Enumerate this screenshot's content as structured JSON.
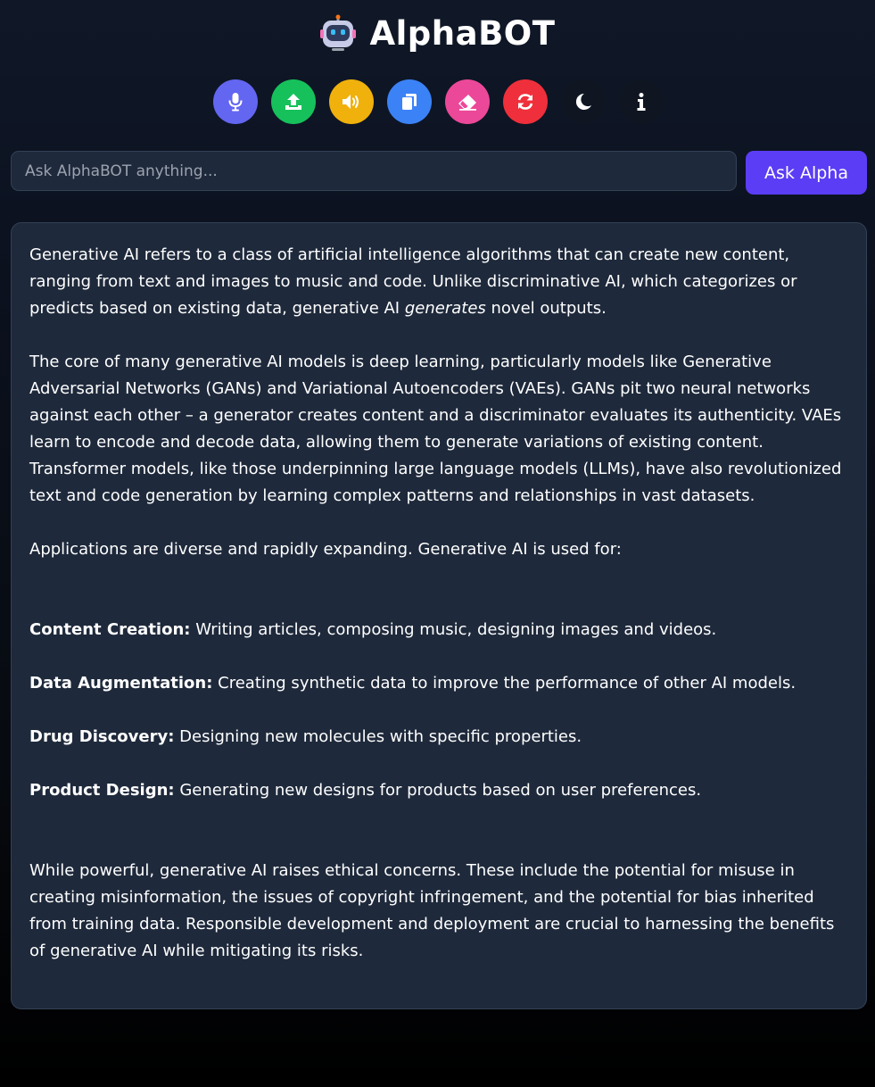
{
  "app": {
    "title": "AlphaBOT",
    "logo_icon": "robot-icon"
  },
  "toolbar": {
    "buttons": [
      {
        "name": "microphone-icon",
        "color": "#6366f1"
      },
      {
        "name": "upload-icon",
        "color": "#16c15b"
      },
      {
        "name": "speaker-icon",
        "color": "#f0b10c"
      },
      {
        "name": "copy-icon",
        "color": "#3b82f6"
      },
      {
        "name": "eraser-icon",
        "color": "#ec4899"
      },
      {
        "name": "refresh-icon",
        "color": "#ef2f3b"
      },
      {
        "name": "moon-icon",
        "color": "#0f1622"
      },
      {
        "name": "info-icon",
        "color": "#0f1622"
      }
    ]
  },
  "search": {
    "placeholder": "Ask AlphaBOT anything...",
    "value": "",
    "button_label": "Ask Alpha"
  },
  "response": {
    "intro_before": "Generative AI refers to a class of artificial intelligence algorithms that can create new content, ranging from text and images to music and code. Unlike discriminative AI, which categorizes or predicts based on existing data, generative AI ",
    "intro_emphasis": "generates",
    "intro_after": " novel outputs.",
    "core": "The core of many generative AI models is deep learning, particularly models like Generative Adversarial Networks (GANs) and Variational Autoencoders (VAEs). GANs pit two neural networks against each other – a generator creates content and a discriminator evaluates its authenticity. VAEs learn to encode and decode data, allowing them to generate variations of existing content.  Transformer models, like those underpinning large language models (LLMs), have also revolutionized text and code generation by learning complex patterns and relationships in vast datasets.",
    "applications_intro": "Applications are diverse and rapidly expanding. Generative AI is used for:",
    "applications": [
      {
        "title": "Content Creation:",
        "text": " Writing articles, composing music, designing images and videos."
      },
      {
        "title": "Data Augmentation:",
        "text": " Creating synthetic data to improve the performance of other AI models."
      },
      {
        "title": "Drug Discovery:",
        "text": " Designing new molecules with specific properties."
      },
      {
        "title": "Product Design:",
        "text": " Generating new designs for products based on user preferences."
      }
    ],
    "conclusion": "While powerful, generative AI raises ethical concerns. These include the potential for misuse in creating misinformation, the issues of copyright infringement, and the potential for bias inherited from training data. Responsible development and deployment are crucial to harnessing the benefits of generative AI while mitigating its risks."
  }
}
